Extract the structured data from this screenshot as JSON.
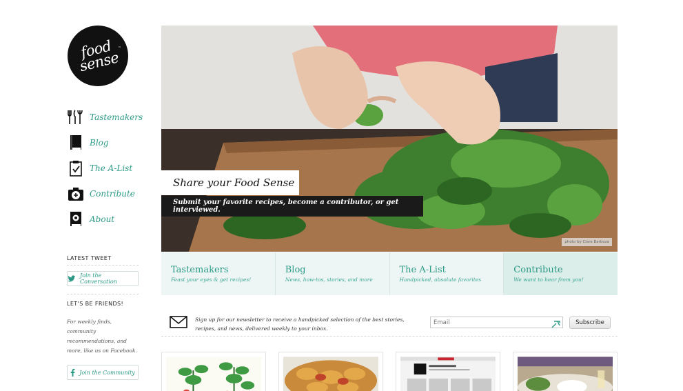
{
  "logo": {
    "text": "food\nsense",
    "tm": "™"
  },
  "nav": [
    {
      "label": "Tastemakers",
      "icon": "utensils-icon"
    },
    {
      "label": "Blog",
      "icon": "book-icon"
    },
    {
      "label": "The A-List",
      "icon": "clipboard-check-icon"
    },
    {
      "label": "Contribute",
      "icon": "camera-plus-icon"
    },
    {
      "label": "About",
      "icon": "address-book-icon"
    }
  ],
  "tweet": {
    "title": "LATEST TWEET",
    "button": "Join the Conversation",
    "icon": "twitter-bird-icon"
  },
  "friends": {
    "title": "LET'S BE FRIENDS!",
    "copy": "For weekly finds, community recommendations, and more, like us on Facebook.",
    "button": "Join the Community",
    "icon": "facebook-icon"
  },
  "hero": {
    "title": "Share your Food Sense",
    "subtitle": "Submit your favorite recipes, become a contributor, or get interviewed.",
    "credit": "photo by Clare Barboza"
  },
  "tabs": [
    {
      "title": "Tastemakers",
      "subtitle": "Feast your eyes & get recipes!"
    },
    {
      "title": "Blog",
      "subtitle": "News, how-tos, stories, and more"
    },
    {
      "title": "The A-List",
      "subtitle": "Handpicked, absolute favorites"
    },
    {
      "title": "Contribute",
      "subtitle": "We want to hear from you!"
    }
  ],
  "newsletter": {
    "text": "Sign up for our newsletter to receive a handpicked selection of the best stories, recipes, and news, delivered weekly to your inbox.",
    "placeholder": "Email",
    "button": "Subscribe",
    "icon": "envelope-icon"
  },
  "cards": [
    {
      "name": "card-plants"
    },
    {
      "name": "card-roasted-food"
    },
    {
      "name": "card-website-screenshot"
    },
    {
      "name": "card-dining-table"
    }
  ],
  "colors": {
    "accent": "#2c9a86",
    "tab_bg": "#eef6f5",
    "tab_active_bg": "#dbeeea",
    "dark": "#1a1a1a"
  }
}
